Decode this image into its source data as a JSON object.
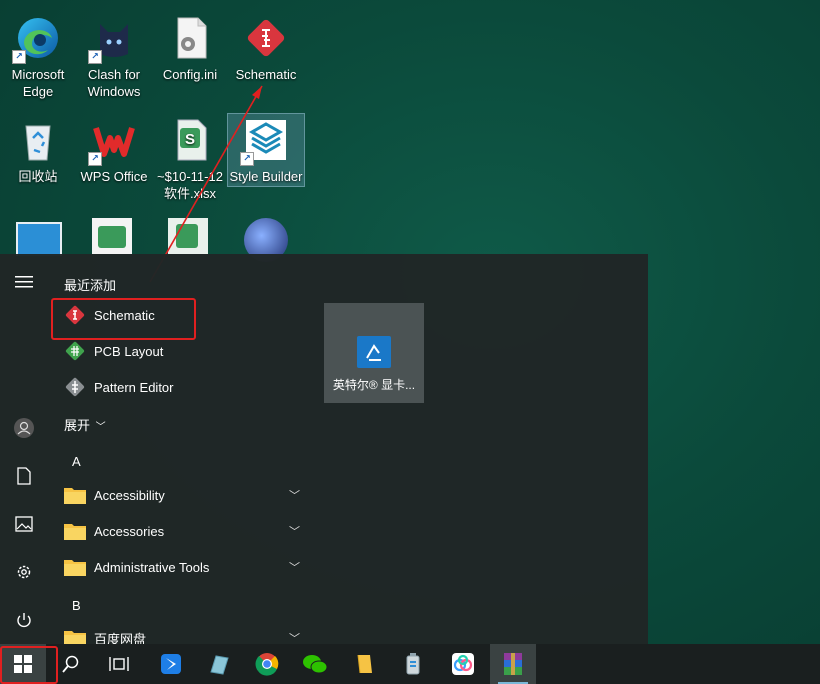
{
  "desktop": {
    "icons": [
      {
        "label": "Microsoft Edge",
        "icon": "edge-icon"
      },
      {
        "label": "Clash for Windows",
        "icon": "clash-cat-icon"
      },
      {
        "label": "Config.ini",
        "icon": "config-file-icon"
      },
      {
        "label": "Schematic",
        "icon": "schematic-icon"
      },
      {
        "label": "回收站",
        "icon": "recycle-bin-icon"
      },
      {
        "label": "WPS Office",
        "icon": "wps-icon"
      },
      {
        "label": "~$10-11-12 软件.xlsx",
        "icon": "spreadsheet-file-icon"
      },
      {
        "label": "Style Builder",
        "icon": "style-builder-icon"
      }
    ]
  },
  "start_menu": {
    "recent_header": "最近添加",
    "recent_apps": [
      {
        "label": "Schematic",
        "icon": "schematic-icon"
      },
      {
        "label": "PCB Layout",
        "icon": "pcb-layout-icon"
      },
      {
        "label": "Pattern Editor",
        "icon": "pattern-editor-icon"
      }
    ],
    "expand_label": "展开",
    "groups": [
      {
        "letter": "A",
        "items": [
          {
            "label": "Accessibility",
            "icon": "folder-icon"
          },
          {
            "label": "Accessories",
            "icon": "folder-icon"
          },
          {
            "label": "Administrative Tools",
            "icon": "folder-icon"
          }
        ]
      },
      {
        "letter": "B",
        "items": [
          {
            "label": "百度网盘",
            "icon": "folder-icon"
          }
        ]
      }
    ],
    "tile": {
      "label": "英特尔® 显卡...",
      "icon": "intel-graphics-icon"
    }
  },
  "taskbar": {
    "items": [
      "start-icon",
      "search-icon",
      "task-view-icon",
      "feishu-icon",
      "notes-icon",
      "chrome-icon",
      "wechat-icon",
      "file-explorer-icon",
      "recycle-app-icon",
      "baidu-netdisk-icon",
      "winrar-icon"
    ]
  },
  "colors": {
    "annotation_red": "#e02020",
    "menu_bg": "#202626",
    "taskbar_bg": "#1a1f1f"
  }
}
